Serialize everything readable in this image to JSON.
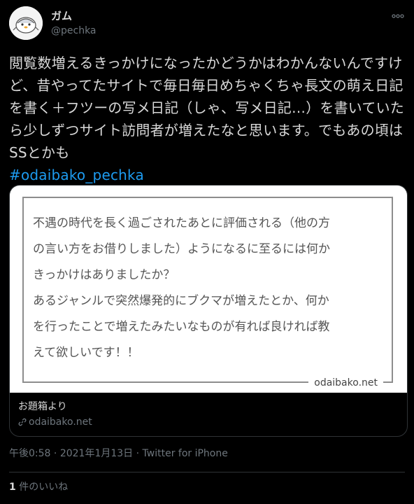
{
  "author": {
    "display_name": "ガム",
    "handle": "@pechka",
    "avatar_icon": "penguin-avatar"
  },
  "tweet": {
    "text": "閲覧数増えるきっかけになったかどうかはわかんないんですけど、昔やってたサイトで毎日毎日めちゃくちゃ長文の萌え日記を書く＋フツーの写メ日記（しゃ、写メ日記…）を書いていたら少しずつサイト訪問者が増えたなと思います。でもあの頃はSSとかも",
    "hashtag": "#odaibako_pechka"
  },
  "card": {
    "question_lines": [
      "不遇の時代を長く過ごされたあとに評価される（他の方",
      "の言い方をお借りしました）ようになるに至るには何か",
      "きっかけはありましたか？",
      "あるジャンルで突然爆発的にブクマが増えたとか、何か",
      "を行ったことで増えたみたいなものが有れば良ければ教",
      "えて欲しいです！！"
    ],
    "watermark": "odaibako.net",
    "title": "お題箱より",
    "domain": "odaibako.net"
  },
  "meta": {
    "time": "午後0:58",
    "separator": "·",
    "date": "2021年1月13日",
    "source": "Twitter for iPhone"
  },
  "likes": {
    "count": "1",
    "label": " 件のいいね"
  },
  "colors": {
    "background": "#000000",
    "text": "#d9d9d9",
    "muted": "#6e767d",
    "link": "#1d9bf0",
    "border": "#2f3336"
  }
}
